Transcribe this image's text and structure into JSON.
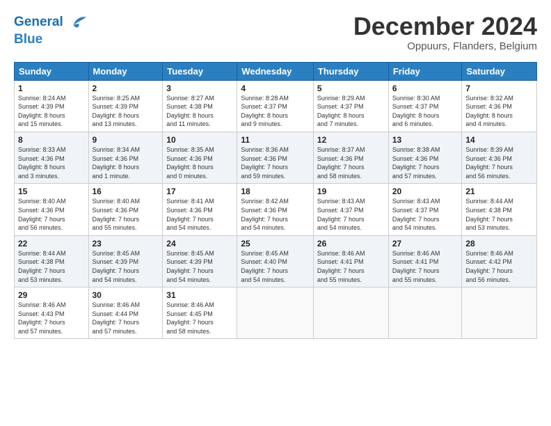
{
  "logo": {
    "line1": "General",
    "line2": "Blue"
  },
  "title": "December 2024",
  "subtitle": "Oppuurs, Flanders, Belgium",
  "days_of_week": [
    "Sunday",
    "Monday",
    "Tuesday",
    "Wednesday",
    "Thursday",
    "Friday",
    "Saturday"
  ],
  "weeks": [
    [
      {
        "day": "1",
        "info": "Sunrise: 8:24 AM\nSunset: 4:39 PM\nDaylight: 8 hours\nand 15 minutes."
      },
      {
        "day": "2",
        "info": "Sunrise: 8:25 AM\nSunset: 4:39 PM\nDaylight: 8 hours\nand 13 minutes."
      },
      {
        "day": "3",
        "info": "Sunrise: 8:27 AM\nSunset: 4:38 PM\nDaylight: 8 hours\nand 11 minutes."
      },
      {
        "day": "4",
        "info": "Sunrise: 8:28 AM\nSunset: 4:37 PM\nDaylight: 8 hours\nand 9 minutes."
      },
      {
        "day": "5",
        "info": "Sunrise: 8:29 AM\nSunset: 4:37 PM\nDaylight: 8 hours\nand 7 minutes."
      },
      {
        "day": "6",
        "info": "Sunrise: 8:30 AM\nSunset: 4:37 PM\nDaylight: 8 hours\nand 6 minutes."
      },
      {
        "day": "7",
        "info": "Sunrise: 8:32 AM\nSunset: 4:36 PM\nDaylight: 8 hours\nand 4 minutes."
      }
    ],
    [
      {
        "day": "8",
        "info": "Sunrise: 8:33 AM\nSunset: 4:36 PM\nDaylight: 8 hours\nand 3 minutes."
      },
      {
        "day": "9",
        "info": "Sunrise: 8:34 AM\nSunset: 4:36 PM\nDaylight: 8 hours\nand 1 minute."
      },
      {
        "day": "10",
        "info": "Sunrise: 8:35 AM\nSunset: 4:36 PM\nDaylight: 8 hours\nand 0 minutes."
      },
      {
        "day": "11",
        "info": "Sunrise: 8:36 AM\nSunset: 4:36 PM\nDaylight: 7 hours\nand 59 minutes."
      },
      {
        "day": "12",
        "info": "Sunrise: 8:37 AM\nSunset: 4:36 PM\nDaylight: 7 hours\nand 58 minutes."
      },
      {
        "day": "13",
        "info": "Sunrise: 8:38 AM\nSunset: 4:36 PM\nDaylight: 7 hours\nand 57 minutes."
      },
      {
        "day": "14",
        "info": "Sunrise: 8:39 AM\nSunset: 4:36 PM\nDaylight: 7 hours\nand 56 minutes."
      }
    ],
    [
      {
        "day": "15",
        "info": "Sunrise: 8:40 AM\nSunset: 4:36 PM\nDaylight: 7 hours\nand 56 minutes."
      },
      {
        "day": "16",
        "info": "Sunrise: 8:40 AM\nSunset: 4:36 PM\nDaylight: 7 hours\nand 55 minutes."
      },
      {
        "day": "17",
        "info": "Sunrise: 8:41 AM\nSunset: 4:36 PM\nDaylight: 7 hours\nand 54 minutes."
      },
      {
        "day": "18",
        "info": "Sunrise: 8:42 AM\nSunset: 4:36 PM\nDaylight: 7 hours\nand 54 minutes."
      },
      {
        "day": "19",
        "info": "Sunrise: 8:43 AM\nSunset: 4:37 PM\nDaylight: 7 hours\nand 54 minutes."
      },
      {
        "day": "20",
        "info": "Sunrise: 8:43 AM\nSunset: 4:37 PM\nDaylight: 7 hours\nand 54 minutes."
      },
      {
        "day": "21",
        "info": "Sunrise: 8:44 AM\nSunset: 4:38 PM\nDaylight: 7 hours\nand 53 minutes."
      }
    ],
    [
      {
        "day": "22",
        "info": "Sunrise: 8:44 AM\nSunset: 4:38 PM\nDaylight: 7 hours\nand 53 minutes."
      },
      {
        "day": "23",
        "info": "Sunrise: 8:45 AM\nSunset: 4:39 PM\nDaylight: 7 hours\nand 54 minutes."
      },
      {
        "day": "24",
        "info": "Sunrise: 8:45 AM\nSunset: 4:39 PM\nDaylight: 7 hours\nand 54 minutes."
      },
      {
        "day": "25",
        "info": "Sunrise: 8:45 AM\nSunset: 4:40 PM\nDaylight: 7 hours\nand 54 minutes."
      },
      {
        "day": "26",
        "info": "Sunrise: 8:46 AM\nSunset: 4:41 PM\nDaylight: 7 hours\nand 55 minutes."
      },
      {
        "day": "27",
        "info": "Sunrise: 8:46 AM\nSunset: 4:41 PM\nDaylight: 7 hours\nand 55 minutes."
      },
      {
        "day": "28",
        "info": "Sunrise: 8:46 AM\nSunset: 4:42 PM\nDaylight: 7 hours\nand 56 minutes."
      }
    ],
    [
      {
        "day": "29",
        "info": "Sunrise: 8:46 AM\nSunset: 4:43 PM\nDaylight: 7 hours\nand 57 minutes."
      },
      {
        "day": "30",
        "info": "Sunrise: 8:46 AM\nSunset: 4:44 PM\nDaylight: 7 hours\nand 57 minutes."
      },
      {
        "day": "31",
        "info": "Sunrise: 8:46 AM\nSunset: 4:45 PM\nDaylight: 7 hours\nand 58 minutes."
      },
      {
        "day": "",
        "info": ""
      },
      {
        "day": "",
        "info": ""
      },
      {
        "day": "",
        "info": ""
      },
      {
        "day": "",
        "info": ""
      }
    ]
  ]
}
